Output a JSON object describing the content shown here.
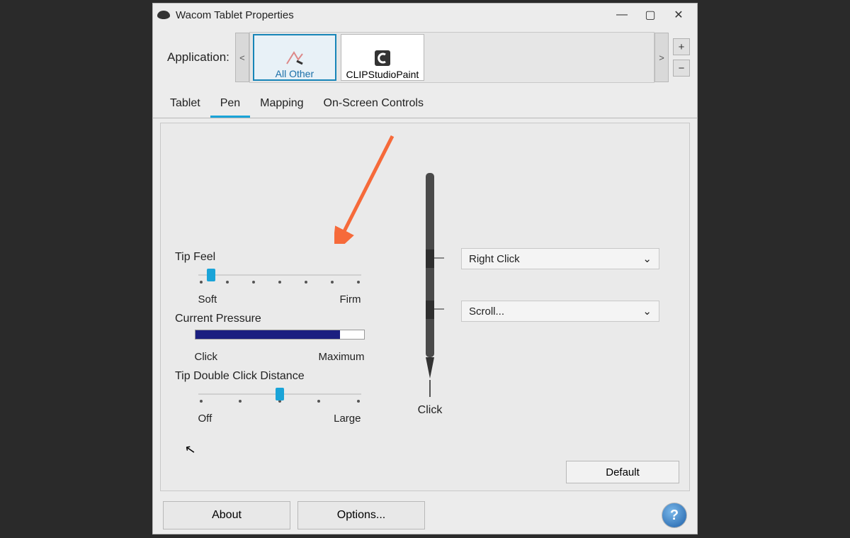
{
  "window": {
    "title": "Wacom Tablet Properties"
  },
  "applicationRow": {
    "label": "Application:",
    "scrollPrev": "<",
    "scrollNext": ">",
    "add": "+",
    "remove": "−",
    "tiles": {
      "allOther": "All Other",
      "clip": "CLIPStudioPaint"
    }
  },
  "tabs": {
    "tablet": "Tablet",
    "pen": "Pen",
    "mapping": "Mapping",
    "osc": "On-Screen Controls"
  },
  "tipFeel": {
    "title": "Tip Feel",
    "leftLabel": "Soft",
    "rightLabel": "Firm",
    "ticks": 7,
    "positionPct": 8
  },
  "currentPressure": {
    "title": "Current Pressure",
    "leftLabel": "Click",
    "rightLabel": "Maximum",
    "fillPct": 86
  },
  "doubleClick": {
    "title": "Tip Double Click Distance",
    "leftLabel": "Off",
    "rightLabel": "Large",
    "ticks": 5,
    "positionPct": 50
  },
  "penButtons": {
    "upper": "Right Click",
    "lower": "Scroll...",
    "tipLabel": "Click"
  },
  "buttons": {
    "default": "Default",
    "about": "About",
    "options": "Options..."
  }
}
